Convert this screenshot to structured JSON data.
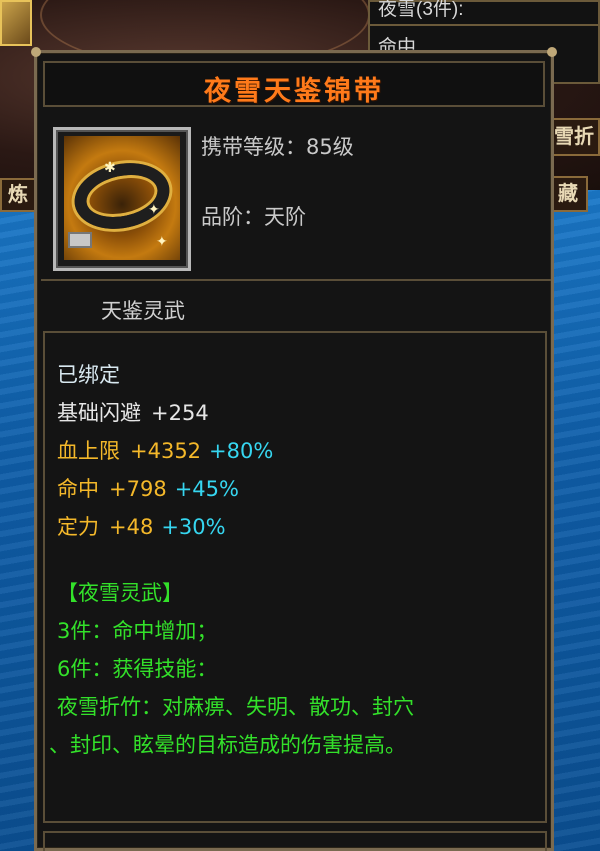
{
  "background": {
    "panel_line1": "夜雪(3件):",
    "panel_line2": "命中",
    "left_tab": "炼",
    "right_tab1": "雪折",
    "right_tab2": "藏"
  },
  "item": {
    "name": "夜雪天鉴锦带",
    "name_color": "#ff7a1a",
    "icon": "belt-icon",
    "level_line": "携带等级：85级",
    "grade_line": "品阶：天阶",
    "set_title": "天鉴灵武"
  },
  "stats": {
    "bound": "已绑定",
    "rows": [
      {
        "label": "基础闪避",
        "base": "+254",
        "pct": "",
        "color": "#e6e6e6"
      },
      {
        "label": "血上限",
        "base": "+4352",
        "pct": "+80%",
        "color": "#f4b82a"
      },
      {
        "label": "命中",
        "base": "+798",
        "pct": "+45%",
        "color": "#f4b82a"
      },
      {
        "label": "定力",
        "base": "+48",
        "pct": "+30%",
        "color": "#f4b82a"
      }
    ]
  },
  "set_bonus": {
    "title": "【夜雪灵武】",
    "line3": "3件：命中增加；",
    "line6": "6件：获得技能：",
    "skill_line1": "夜雪折竹：对麻痹、失明、散功、封穴",
    "skill_line2": "、封印、眩晕的目标造成的伤害提高。",
    "color": "#33e12a"
  }
}
